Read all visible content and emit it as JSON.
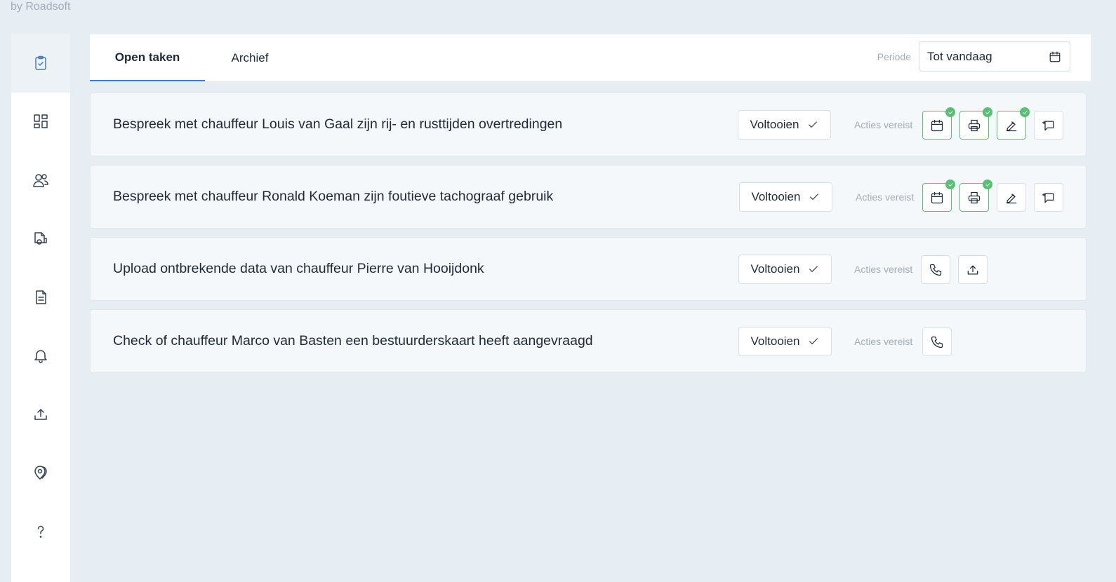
{
  "brand": "by Roadsoft",
  "colors": {
    "accent": "#4e7bb8",
    "done": "#5cbd77",
    "muted": "#a3acb6"
  },
  "sidebar": {
    "items": [
      {
        "name": "tasks",
        "icon": "clipboard-check-icon",
        "active": true
      },
      {
        "name": "dashboard",
        "icon": "grid-icon"
      },
      {
        "name": "drivers",
        "icon": "users-icon"
      },
      {
        "name": "vehicles",
        "icon": "truck-icon"
      },
      {
        "name": "documents",
        "icon": "document-icon"
      },
      {
        "name": "notifications",
        "icon": "bell-icon"
      },
      {
        "name": "upload",
        "icon": "upload-icon"
      },
      {
        "name": "locations",
        "icon": "map-pin-icon"
      },
      {
        "name": "help",
        "icon": "question-icon"
      }
    ]
  },
  "tabs": {
    "open": "Open taken",
    "archive": "Archief"
  },
  "periode": {
    "label": "Periode",
    "value": "Tot vandaag"
  },
  "tasks": [
    {
      "title": "Bespreek met chauffeur Louis van Gaal zijn rij- en rusttijden overtredingen",
      "complete_label": "Voltooien",
      "actions_label": "Acties vereist",
      "actions": [
        {
          "icon": "calendar-icon",
          "done": true
        },
        {
          "icon": "printer-icon",
          "done": true
        },
        {
          "icon": "pen-icon",
          "done": true
        },
        {
          "icon": "comment-icon",
          "done": false
        }
      ]
    },
    {
      "title": "Bespreek met chauffeur Ronald Koeman zijn foutieve tachograaf gebruik",
      "complete_label": "Voltooien",
      "actions_label": "Acties vereist",
      "actions": [
        {
          "icon": "calendar-icon",
          "done": true
        },
        {
          "icon": "printer-icon",
          "done": true
        },
        {
          "icon": "pen-icon",
          "done": false
        },
        {
          "icon": "comment-icon",
          "done": false
        }
      ]
    },
    {
      "title": "Upload ontbrekende data van chauffeur Pierre van Hooijdonk",
      "complete_label": "Voltooien",
      "actions_label": "Acties vereist",
      "actions": [
        {
          "icon": "phone-icon",
          "done": false
        },
        {
          "icon": "upload-icon",
          "done": false
        }
      ]
    },
    {
      "title": "Check of chauffeur Marco van Basten een bestuurderskaart heeft aangevraagd",
      "complete_label": "Voltooien",
      "actions_label": "Acties vereist",
      "actions": [
        {
          "icon": "phone-icon",
          "done": false
        }
      ]
    }
  ]
}
